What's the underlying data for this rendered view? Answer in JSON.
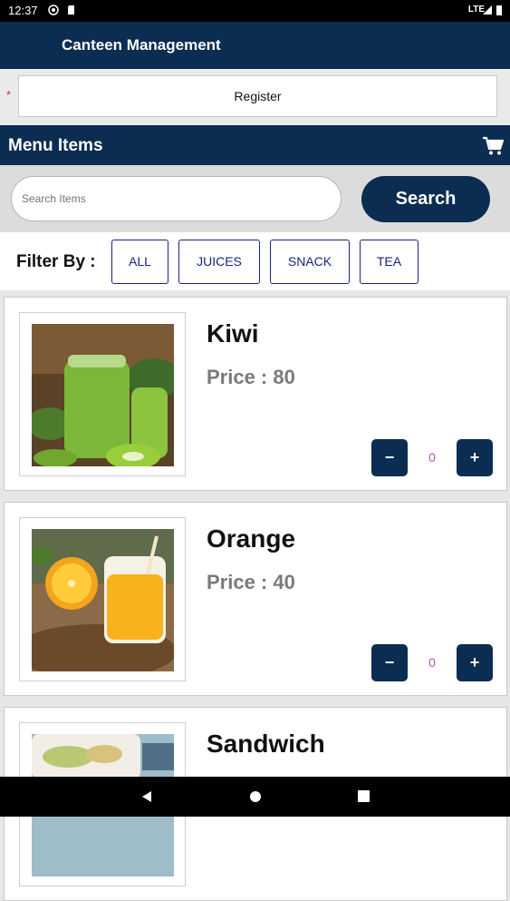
{
  "status_bar": {
    "time": "12:37",
    "network": "LTE"
  },
  "app_bar": {
    "title": "Canteen Management"
  },
  "register": {
    "required_mark": "*",
    "label": "Register"
  },
  "menu_header": {
    "title": "Menu Items",
    "cart_icon": "cart-icon"
  },
  "search": {
    "placeholder": "Search Items",
    "value": "",
    "button_label": "Search"
  },
  "filter": {
    "label": "Filter By :",
    "options": [
      "ALL",
      "JUICES",
      "SNACK",
      "TEA"
    ]
  },
  "items": [
    {
      "name": "Kiwi",
      "price": "Price : 80",
      "quantity": "0",
      "image": "kiwi-juice-image"
    },
    {
      "name": "Orange",
      "price": "Price : 40",
      "quantity": "0",
      "image": "orange-juice-image"
    },
    {
      "name": "Sandwich",
      "price": "",
      "quantity": "",
      "image": "sandwich-image"
    }
  ],
  "stepper": {
    "decrement_label": "−",
    "increment_label": "+"
  },
  "colors": {
    "primary": "#0b2d52",
    "filter_accent": "#1a237e",
    "quantity_text": "#b05aa8",
    "price_text": "#7a7a7a"
  }
}
